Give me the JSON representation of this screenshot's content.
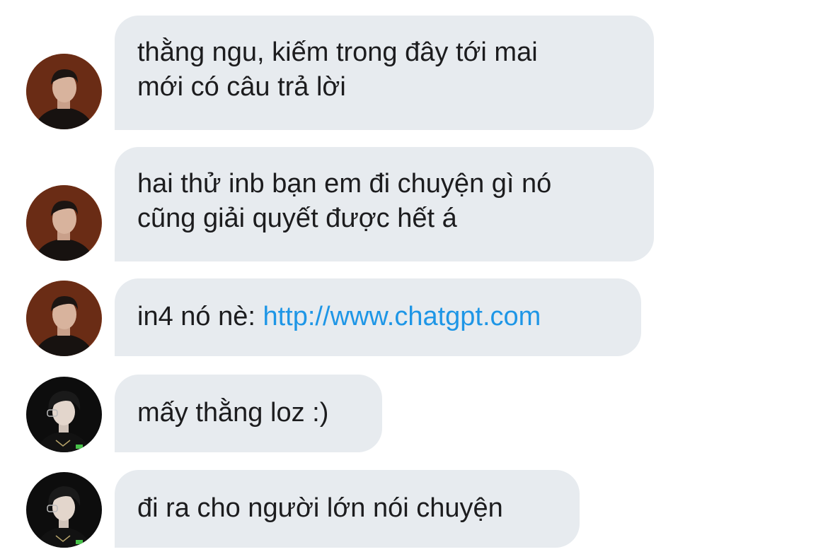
{
  "chat": {
    "messages": [
      {
        "sender": "friend-1",
        "lines": [
          "thằng ngu, kiếm trong đây tới mai",
          "mới có câu trả lời"
        ]
      },
      {
        "sender": "friend-1",
        "lines": [
          "hai thử inb bạn em đi chuyện gì nó",
          "cũng giải quyết được hết á"
        ]
      },
      {
        "sender": "friend-1",
        "prefix": "in4 nó nè: ",
        "link": "http://www.chatgpt.com"
      },
      {
        "sender": "friend-2",
        "lines": [
          "mấy thằng loz :)"
        ]
      },
      {
        "sender": "friend-2",
        "lines": [
          "đi ra cho người lớn nói chuyện"
        ]
      }
    ]
  },
  "colors": {
    "bubble_bg": "#e7ebef",
    "text": "#1c1c1e",
    "link": "#1e96e6"
  }
}
